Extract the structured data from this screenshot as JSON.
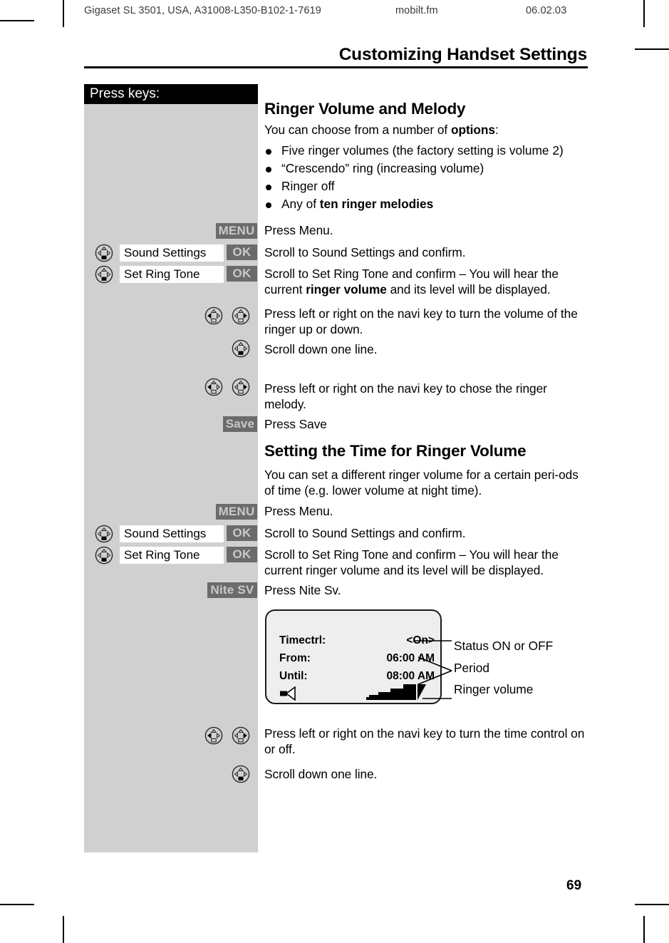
{
  "running_head": {
    "left": "Gigaset SL 3501, USA, A31008-L350-B102-1-7619",
    "middle": "mobilt.fm",
    "right": "06.02.03"
  },
  "chapter_title": "Customizing Handset Settings",
  "page_number": "69",
  "left_column": {
    "header": "Press keys:",
    "softkeys": {
      "menu": "MENU",
      "ok": "OK",
      "save": "Save",
      "nite_sv": "Nite SV"
    },
    "menu_fields": {
      "sound_settings": "Sound Settings",
      "set_ring_tone": "Set Ring Tone"
    }
  },
  "sections": [
    {
      "heading": "Ringer Volume and Melody",
      "intro_prefix": "You can choose from a number of ",
      "intro_bold": "options",
      "intro_suffix": ":",
      "bullets": [
        "Five ringer volumes (the factory setting is volume 2)",
        "“Crescendo” ring (increasing volume)",
        "Ringer off"
      ],
      "bullet_last_prefix": "Any of ",
      "bullet_last_bold": "ten ringer melodies"
    },
    {
      "heading": "Setting the Time for Ringer Volume",
      "intro": "You can set a different ringer volume for a certain peri-ods of time (e.g. lower volume at night time)."
    }
  ],
  "steps": {
    "s1": "Press Menu.",
    "s2": "Scroll to Sound Settings and confirm.",
    "s3_a": "Scroll to Set Ring Tone and confirm – You will hear the current ",
    "s3_b": "ringer volume",
    "s3_c": " and its level will be displayed.",
    "s4": "Press left or right on the navi key to turn the volume of the ringer up or down.",
    "s5": "Scroll down one line.",
    "s6": "Press left or right on the navi key to chose the ringer melody.",
    "s7": "Press Save",
    "s8": "Press Menu.",
    "s9": "Scroll to Sound Settings and confirm.",
    "s10": "Scroll to Set Ring Tone and confirm – You will hear the current ringer volume and its level will be displayed.",
    "s11": "Press Nite Sv.",
    "s12": "Press left or right on the navi key to turn the time control on or off.",
    "s13": "Scroll down one line."
  },
  "display": {
    "rows": [
      {
        "label": "Timectrl:",
        "value": "<On>"
      },
      {
        "label": "From:",
        "value": "06:00 AM"
      },
      {
        "label": "Until:",
        "value": "08:00 AM"
      }
    ],
    "speaker_icon": "speaker-icon",
    "volume_icon": "volume-level-icon"
  },
  "annotations": [
    "Status ON or OFF",
    "Period",
    "Ringer volume"
  ],
  "colors": {
    "panel_gray": "#d0d0d0",
    "softkey_gray": "#6b6b6b",
    "softkey_text": "#c9c9c9",
    "header_black": "#000000",
    "lcd_bg": "#eeeeee"
  }
}
